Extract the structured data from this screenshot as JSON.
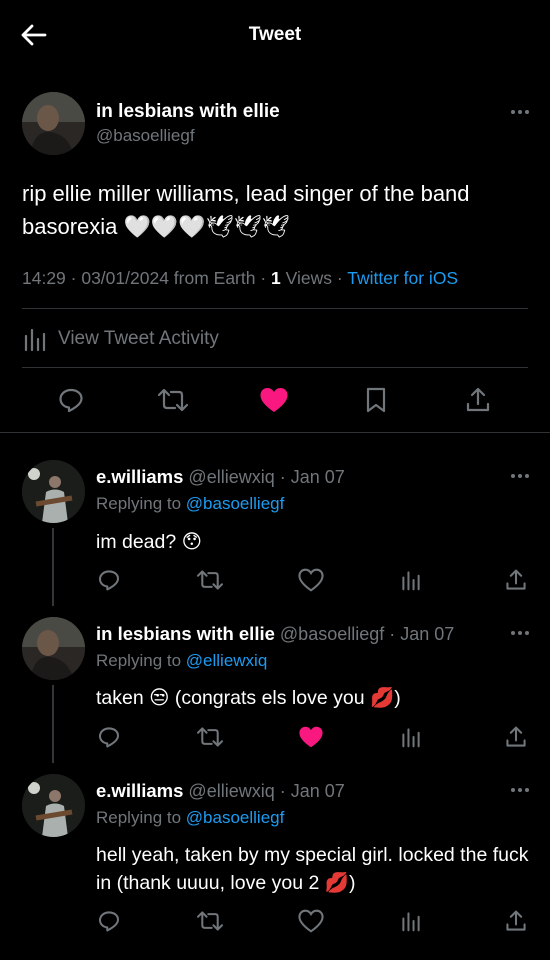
{
  "header": {
    "title": "Tweet",
    "back_icon": "arrow-left-icon"
  },
  "main_tweet": {
    "display_name": "in lesbians with ellie",
    "handle": "@basoelliegf",
    "text": "rip ellie miller williams, lead singer of the band basorexia 🤍🤍🤍🕊🕊🕊",
    "time": "14:29 · 03/01/2024 from Earth · ",
    "views_count": "1",
    "views_label": " Views · ",
    "source": "Twitter for iOS",
    "activity_label": "View Tweet Activity",
    "liked": true,
    "like_color": "#f91880"
  },
  "replies": [
    {
      "display_name": "e.williams",
      "handle_date": "@elliewxiq · Jan 07",
      "replying_prefix": "Replying to ",
      "replying_to": "@basoelliegf",
      "text": "im dead? 😯",
      "liked": false
    },
    {
      "display_name": "in lesbians with ellie",
      "handle_date": "@basoelliegf · Jan 07",
      "replying_prefix": "Replying to ",
      "replying_to": "@elliewxiq",
      "text": "taken 😒 (congrats els love you 💋)",
      "liked": true
    },
    {
      "display_name": "e.williams",
      "handle_date": "@elliewxiq · Jan 07",
      "replying_prefix": "Replying to ",
      "replying_to": "@basoelliegf",
      "text": "hell yeah, taken by my special girl. locked the fuck in (thank uuuu, love you 2 💋)",
      "liked": false
    }
  ],
  "colors": {
    "background": "#000000",
    "text": "#e7e9ea",
    "muted": "#71767b",
    "link": "#1d9bf0",
    "like": "#f91880",
    "divider": "#2f3336"
  }
}
